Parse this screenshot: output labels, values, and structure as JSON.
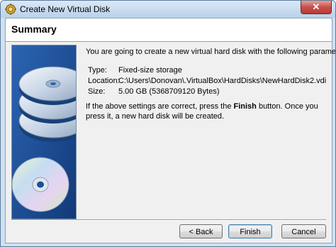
{
  "window": {
    "title": "Create New Virtual Disk",
    "close_glyph": "✕"
  },
  "header": {
    "title": "Summary"
  },
  "summary": {
    "intro": "You are going to create a new virtual hard disk with the following parameters:",
    "params": [
      {
        "label": "Type:",
        "value": "Fixed-size storage"
      },
      {
        "label": "Location:",
        "value": "C:\\Users\\Donovan\\.VirtualBox\\HardDisks\\NewHardDisk2.vdi"
      },
      {
        "label": "Size:",
        "value": "5.00 GB (5368709120 Bytes)"
      }
    ],
    "confirm_before": "If the above settings are correct, press the ",
    "confirm_bold": "Finish",
    "confirm_after": " button. Once you press it, a new hard disk will be created."
  },
  "buttons": {
    "back": "< Back",
    "finish": "Finish",
    "cancel": "Cancel"
  },
  "icons": {
    "title": "gear-disk-icon",
    "art": "stacked-disks-illustration"
  },
  "colors": {
    "art_background": "#1e4f96",
    "close_button": "#c75050"
  }
}
